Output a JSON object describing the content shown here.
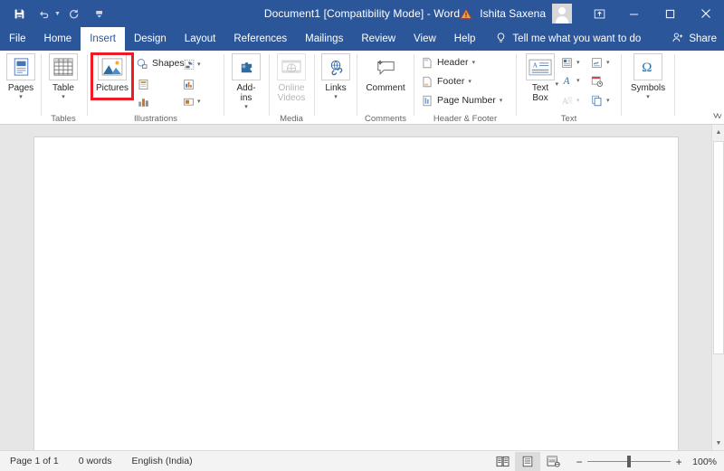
{
  "titlebar": {
    "quick_access": [
      {
        "name": "save-icon",
        "label": "Save"
      },
      {
        "name": "undo-icon",
        "label": "Undo"
      },
      {
        "name": "redo-icon",
        "label": "Redo"
      },
      {
        "name": "customize-quick-access-icon",
        "label": "Customize Quick Access Toolbar"
      }
    ],
    "document_title": "Document1 [Compatibility Mode]  -  Word",
    "warning_icon": "warning-triangle-icon",
    "account_name": "Ishita Saxena",
    "ribbon_display_options": "ribbon-display-options-icon",
    "minimize": "minimize-icon",
    "restore": "restore-icon",
    "close": "close-icon",
    "accent_color": "#2b579a"
  },
  "tabs": [
    {
      "label": "File",
      "active": false
    },
    {
      "label": "Home",
      "active": false
    },
    {
      "label": "Insert",
      "active": true
    },
    {
      "label": "Design",
      "active": false
    },
    {
      "label": "Layout",
      "active": false
    },
    {
      "label": "References",
      "active": false
    },
    {
      "label": "Mailings",
      "active": false
    },
    {
      "label": "Review",
      "active": false
    },
    {
      "label": "View",
      "active": false
    },
    {
      "label": "Help",
      "active": false
    }
  ],
  "tell_me": {
    "icon": "lightbulb-icon",
    "label": "Tell me what you want to do"
  },
  "share": {
    "icon": "share-person-icon",
    "label": "Share"
  },
  "ribbon": {
    "groups": [
      {
        "name": "pages",
        "label": "",
        "buttons": [
          {
            "name": "pages-button",
            "label": "Pages",
            "icon": "cover-page-icon",
            "dropdown": true,
            "disabled": false
          }
        ]
      },
      {
        "name": "tables",
        "label": "Tables",
        "buttons": [
          {
            "name": "table-button",
            "label": "Table",
            "icon": "table-grid-icon",
            "dropdown": true,
            "disabled": false
          }
        ]
      },
      {
        "name": "illustrations",
        "label": "Illustrations",
        "buttons": [
          {
            "name": "pictures-button",
            "label": "Pictures",
            "icon": "picture-mountain-icon",
            "dropdown": false,
            "disabled": false,
            "highlighted": true
          }
        ],
        "small_items": [
          {
            "name": "shapes-button",
            "label": "Shapes",
            "icon": "shapes-icon",
            "dropdown": true
          },
          {
            "name": "icons-button",
            "label": "",
            "icon": "icons-icon",
            "dropdown": false
          },
          {
            "name": "smartart-button",
            "label": "",
            "icon": "smartart-icon",
            "dropdown": false
          },
          {
            "name": "chart-button",
            "label": "",
            "icon": "chart-icon",
            "dropdown": false
          },
          {
            "name": "3d-model-button",
            "label": "",
            "icon": "3d-model-icon",
            "dropdown": true
          },
          {
            "name": "screenshot-button",
            "label": "",
            "icon": "screenshot-icon",
            "dropdown": true
          }
        ]
      },
      {
        "name": "add-ins",
        "label": "",
        "buttons": [
          {
            "name": "add-ins-button",
            "label": "Add-\nins",
            "icon": "add-ins-puzzle-icon",
            "dropdown": true,
            "disabled": false
          }
        ]
      },
      {
        "name": "media",
        "label": "Media",
        "buttons": [
          {
            "name": "online-videos-button",
            "label": "Online\nVideos",
            "icon": "online-video-icon",
            "dropdown": false,
            "disabled": true
          }
        ]
      },
      {
        "name": "links",
        "label": "",
        "buttons": [
          {
            "name": "links-button",
            "label": "Links",
            "icon": "link-globe-icon",
            "dropdown": true,
            "disabled": false
          }
        ]
      },
      {
        "name": "comments",
        "label": "Comments",
        "buttons": [
          {
            "name": "comment-button",
            "label": "Comment",
            "icon": "new-comment-icon",
            "dropdown": false,
            "disabled": false
          }
        ]
      },
      {
        "name": "header-footer",
        "label": "Header & Footer",
        "small_items": [
          {
            "name": "header-button",
            "label": "Header",
            "icon": "header-page-icon",
            "dropdown": true
          },
          {
            "name": "footer-button",
            "label": "Footer",
            "icon": "footer-page-icon",
            "dropdown": true
          },
          {
            "name": "page-number-button",
            "label": "Page Number",
            "icon": "page-number-icon",
            "dropdown": true
          }
        ]
      },
      {
        "name": "text",
        "label": "Text",
        "buttons": [
          {
            "name": "text-box-button",
            "label": "Text\nBox",
            "icon": "text-box-icon",
            "dropdown": true,
            "disabled": false
          }
        ],
        "small_items": [
          {
            "name": "quick-parts-button",
            "label": "",
            "icon": "quick-parts-icon",
            "dropdown": true
          },
          {
            "name": "wordart-button",
            "label": "",
            "icon": "wordart-icon",
            "dropdown": true
          },
          {
            "name": "drop-cap-button",
            "label": "",
            "icon": "drop-cap-icon",
            "dropdown": true,
            "disabled": true
          },
          {
            "name": "signature-line-button",
            "label": "",
            "icon": "signature-line-icon",
            "dropdown": true
          },
          {
            "name": "date-time-button",
            "label": "",
            "icon": "date-time-icon",
            "dropdown": false
          },
          {
            "name": "object-button",
            "label": "",
            "icon": "object-icon",
            "dropdown": true
          }
        ]
      },
      {
        "name": "symbols",
        "label": "",
        "buttons": [
          {
            "name": "symbols-button",
            "label": "Symbols",
            "icon": "omega-icon",
            "dropdown": true,
            "disabled": false
          }
        ]
      }
    ],
    "collapse_ribbon_icon": "chevron-up-icon",
    "highlight_color": "#ee1b24"
  },
  "document": {
    "page_background": "#ffffff",
    "canvas_background": "#e6e6e6"
  },
  "scrollbar": {
    "up_arrow": "scroll-up-arrow-icon",
    "down_arrow": "scroll-down-arrow-icon",
    "thumb": "scroll-thumb"
  },
  "statusbar": {
    "page_info": "Page 1 of 1",
    "word_count": "0 words",
    "language": "English (India)",
    "views": [
      {
        "name": "read-mode-view-button",
        "icon": "read-mode-icon",
        "active": false
      },
      {
        "name": "print-layout-view-button",
        "icon": "print-layout-icon",
        "active": true
      },
      {
        "name": "web-layout-view-button",
        "icon": "web-layout-icon",
        "active": false
      }
    ],
    "zoom_out": "−",
    "zoom_in": "+",
    "zoom_level": "100%"
  }
}
